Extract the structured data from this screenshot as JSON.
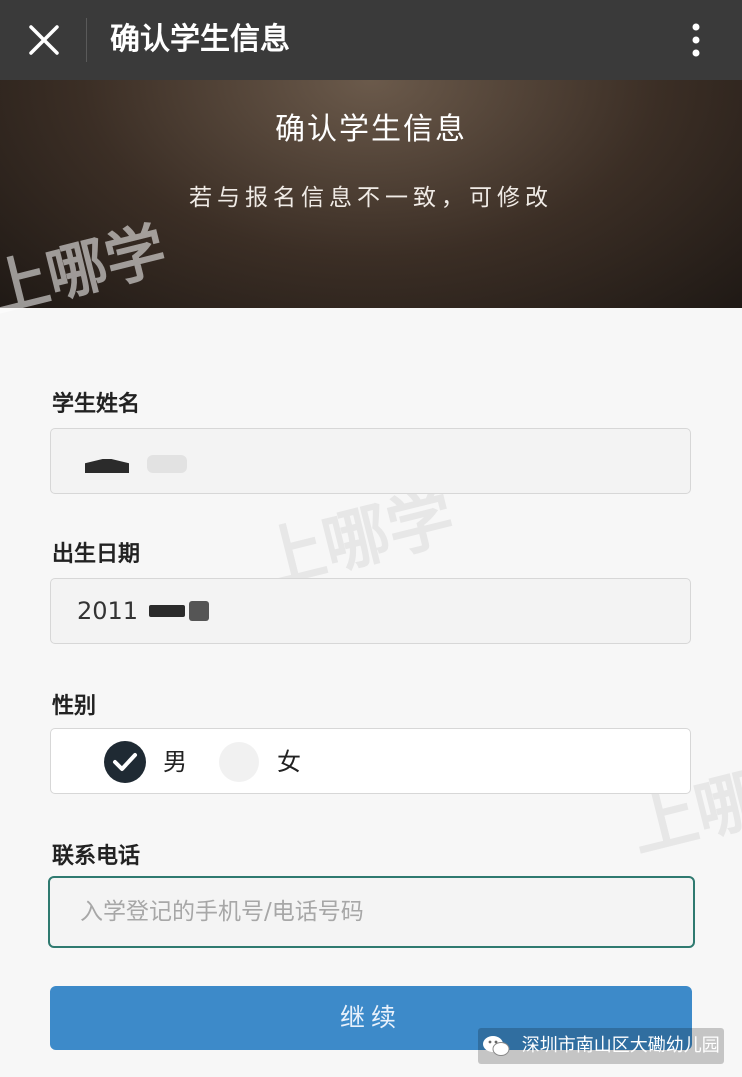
{
  "topbar": {
    "title": "确认学生信息",
    "close_icon": "close-icon",
    "more_icon": "more-vertical-icon"
  },
  "banner": {
    "title": "确认学生信息",
    "subtitle": "若与报名信息不一致，可修改"
  },
  "form": {
    "name": {
      "label": "学生姓名",
      "value": ""
    },
    "birthdate": {
      "label": "出生日期",
      "value": "2011"
    },
    "gender": {
      "label": "性别",
      "options": [
        {
          "label": "男",
          "selected": true
        },
        {
          "label": "女",
          "selected": false
        }
      ]
    },
    "phone": {
      "label": "联系电话",
      "placeholder": "入学登记的手机号/电话号码",
      "value": ""
    },
    "continue_label": "继续"
  },
  "watermark": {
    "text": "上哪学",
    "subtext": "上哪学"
  },
  "footer": {
    "account": "深圳市南山区大磡幼儿园",
    "icon": "wechat-icon"
  },
  "colors": {
    "topbar_bg": "#3a3a3a",
    "primary_button": "#3d8ac9",
    "focus_border": "#2f7a70",
    "check_icon_bg": "#1f2a33"
  }
}
